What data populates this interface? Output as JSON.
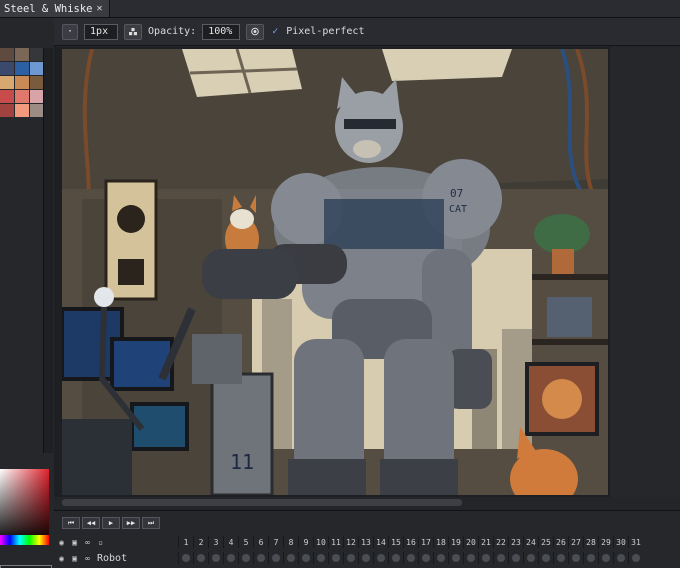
{
  "document_tab": {
    "title": "Steel & Whiske",
    "close": "✕"
  },
  "toolbar": {
    "dot_button": "·",
    "brush_size": "1px",
    "opacity_label": "Opacity:",
    "opacity_value": "100%",
    "pixel_perfect_checked": true,
    "pixel_perfect_check": "✓",
    "pixel_perfect_label": "Pixel-perfect"
  },
  "palette": {
    "swatches": [
      "#5e4a3f",
      "#7b6757",
      "#36373b",
      "#3b4a6c",
      "#2d5fa3",
      "#6d98d0",
      "#d7a870",
      "#c88b55",
      "#7a5b3d",
      "#c94c4c",
      "#e0786b",
      "#d8a4a8",
      "#a0433f",
      "#f19a7e",
      "#9b8d86"
    ]
  },
  "color_picker": {
    "primary": "#e0232d"
  },
  "timeline": {
    "play_buttons": [
      "⏮",
      "◀◀",
      "▶",
      "▶▶",
      "⏭"
    ],
    "layer_name": "Robot",
    "frames": [
      "1",
      "2",
      "3",
      "4",
      "5",
      "6",
      "7",
      "8",
      "9",
      "10",
      "11",
      "12",
      "13",
      "14",
      "15",
      "16",
      "17",
      "18",
      "19",
      "20",
      "21",
      "22",
      "23",
      "24",
      "25",
      "26",
      "27",
      "28",
      "29",
      "30",
      "31"
    ]
  },
  "colors": {
    "accent": "#6fa9ff"
  }
}
